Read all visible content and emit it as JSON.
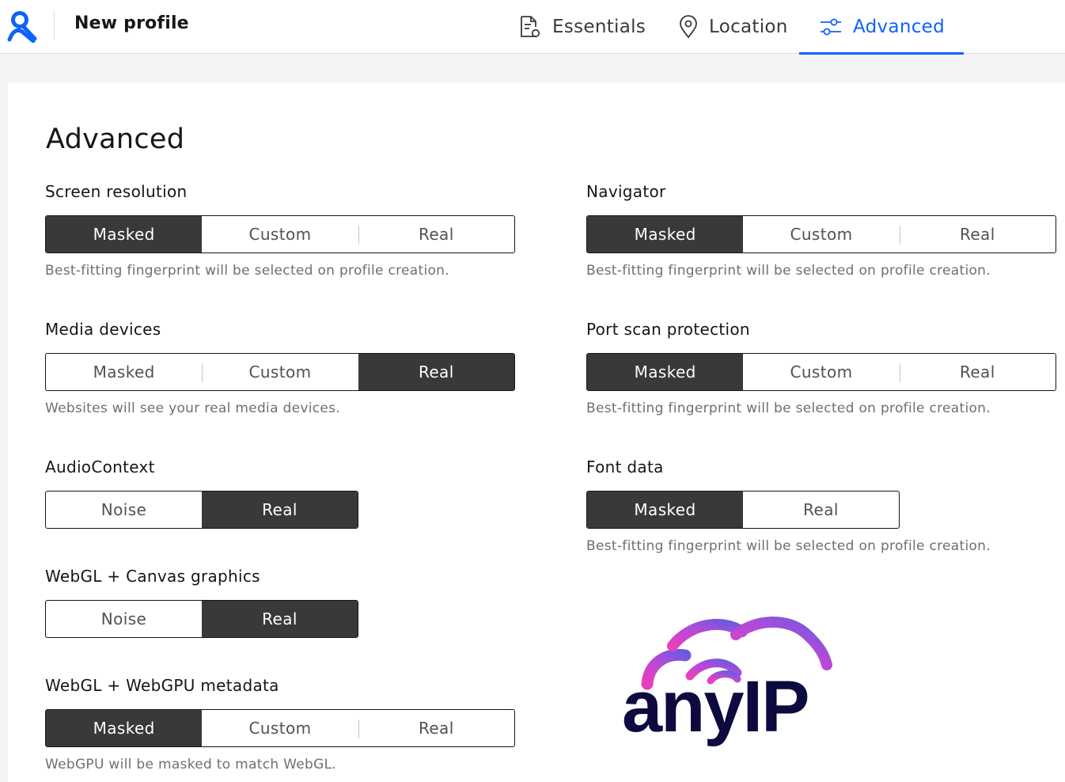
{
  "header": {
    "title": "New profile",
    "tabs": [
      {
        "label": "Essentials",
        "icon": "document-gear-icon",
        "active": false
      },
      {
        "label": "Location",
        "icon": "location-pin-icon",
        "active": false
      },
      {
        "label": "Advanced",
        "icon": "settings-sliders-icon",
        "active": true
      }
    ]
  },
  "colors": {
    "accent": "#0f62fe",
    "selected": "#393939"
  },
  "main": {
    "heading": "Advanced",
    "fields": {
      "screen_resolution": {
        "label": "Screen resolution",
        "options": [
          "Masked",
          "Custom",
          "Real"
        ],
        "selected": "Masked",
        "hint": "Best-fitting fingerprint will be selected on profile creation."
      },
      "navigator": {
        "label": "Navigator",
        "options": [
          "Masked",
          "Custom",
          "Real"
        ],
        "selected": "Masked",
        "hint": "Best-fitting fingerprint will be selected on profile creation."
      },
      "media_devices": {
        "label": "Media devices",
        "options": [
          "Masked",
          "Custom",
          "Real"
        ],
        "selected": "Real",
        "hint": "Websites will see your real media devices."
      },
      "port_scan": {
        "label": "Port scan protection",
        "options": [
          "Masked",
          "Custom",
          "Real"
        ],
        "selected": "Masked",
        "hint": "Best-fitting fingerprint will be selected on profile creation."
      },
      "audio_context": {
        "label": "AudioContext",
        "options": [
          "Noise",
          "Real"
        ],
        "selected": "Real"
      },
      "font_data": {
        "label": "Font data",
        "options": [
          "Masked",
          "Real"
        ],
        "selected": "Masked",
        "hint": "Best-fitting fingerprint will be selected on profile creation."
      },
      "webgl_canvas": {
        "label": "WebGL + Canvas graphics",
        "options": [
          "Noise",
          "Real"
        ],
        "selected": "Real"
      },
      "webgl_webgpu": {
        "label": "WebGL + WebGPU metadata",
        "options": [
          "Masked",
          "Custom",
          "Real"
        ],
        "selected": "Masked",
        "hint": "WebGPU will be masked to match WebGL."
      }
    }
  },
  "brand": {
    "name": "anyIP",
    "icon": "cloud-wifi-logo-icon"
  }
}
